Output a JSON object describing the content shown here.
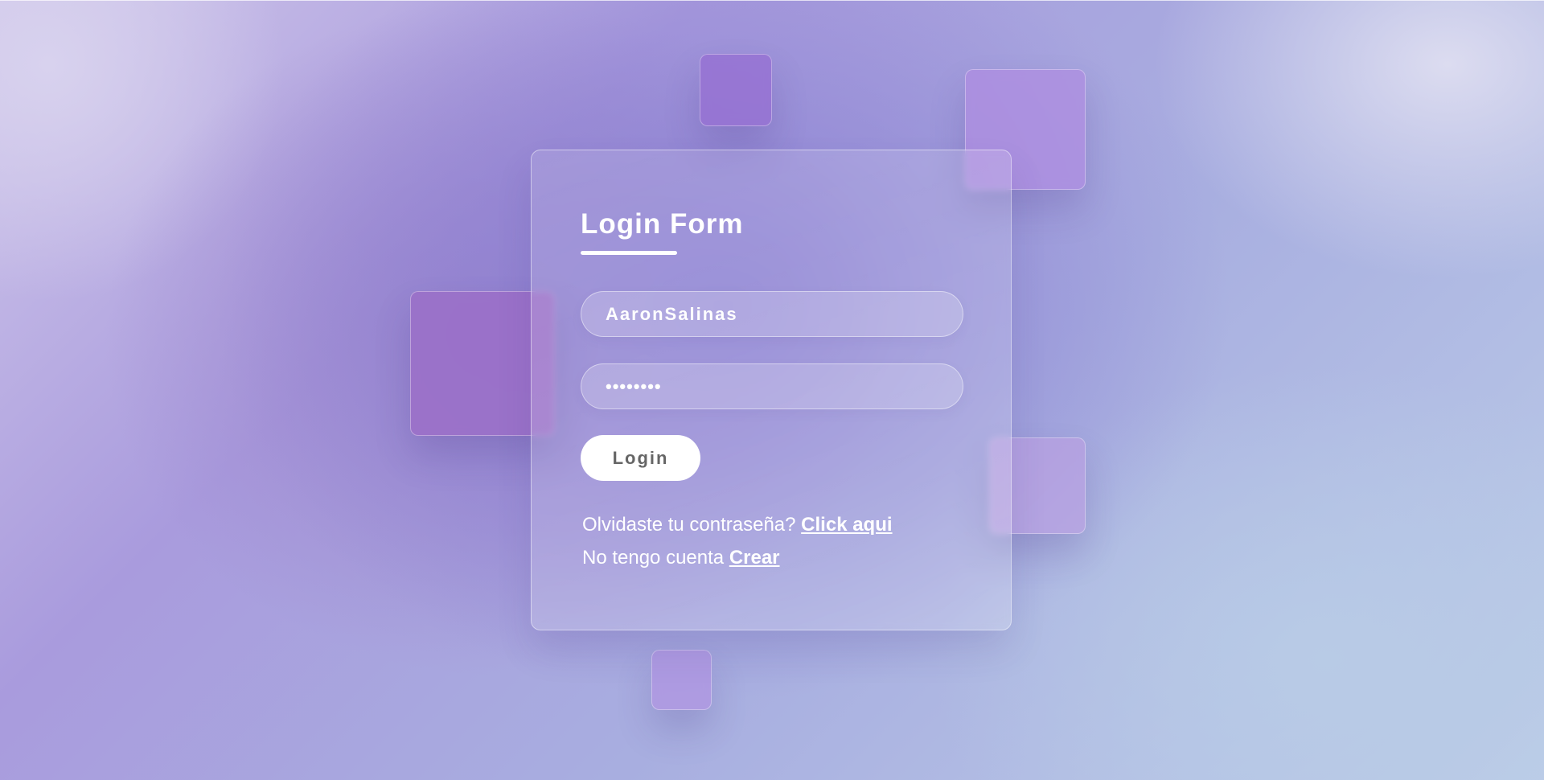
{
  "login_form": {
    "title": "Login Form",
    "username_value": "AaronSalinas",
    "password_value": "••••••••",
    "login_button_label": "Login",
    "forgot_text": "Olvidaste tu contraseña?",
    "forgot_link": "Click aqui",
    "no_account_text": "No tengo cuenta",
    "create_link": "Crear"
  },
  "colors": {
    "accent": "#8a7fd2",
    "button_text": "#666666",
    "text": "#ffffff"
  }
}
